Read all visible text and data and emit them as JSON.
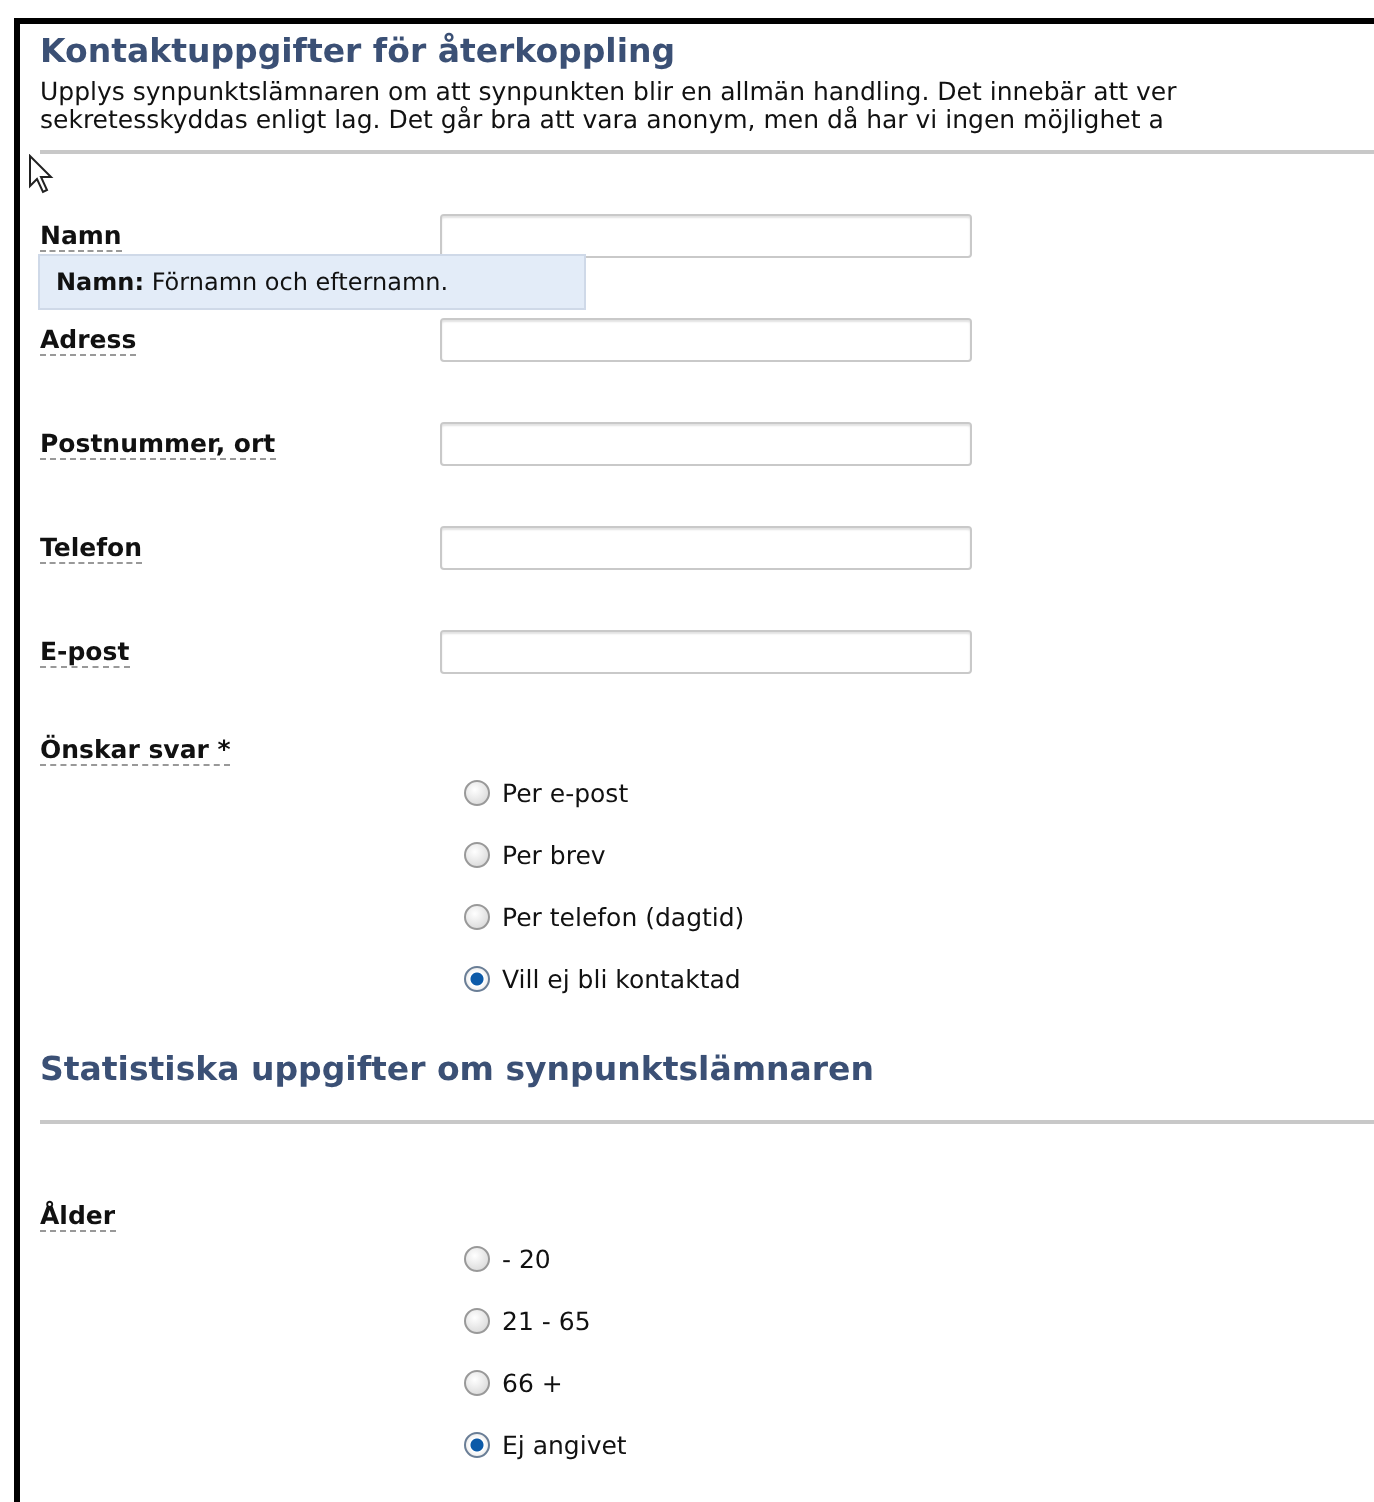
{
  "sections": [
    {
      "heading": "Kontaktuppgifter för återkoppling",
      "intro": [
        "Upplys synpunktslämnaren om att synpunkten blir en allmän handling. Det innebär att ver",
        "sekretesskyddas enligt lag. Det går bra att vara anonym, men då har vi ingen möjlighet a"
      ],
      "fields": [
        {
          "kind": "text",
          "label": "Namn",
          "tooltip": "**Namn:** Förnamn och efternamn."
        },
        {
          "kind": "text",
          "label": "Adress"
        },
        {
          "kind": "text",
          "label": "Postnummer, ort"
        },
        {
          "kind": "text",
          "label": "Telefon"
        },
        {
          "kind": "text",
          "label": "E-post"
        },
        {
          "kind": "radio",
          "label": "Önskar svar *",
          "options": [
            {
              "label": "Per e-post",
              "selected": false
            },
            {
              "label": "Per brev",
              "selected": false
            },
            {
              "label": "Per telefon (dagtid)",
              "selected": false
            },
            {
              "label": "Vill ej bli kontaktad",
              "selected": true
            }
          ]
        }
      ]
    },
    {
      "heading": "Statistiska uppgifter om synpunktslämnaren",
      "fields": [
        {
          "kind": "radio",
          "label": "Ålder",
          "options": [
            {
              "label": "- 20",
              "selected": false
            },
            {
              "label": "21 - 65",
              "selected": false
            },
            {
              "label": "66 +",
              "selected": false
            },
            {
              "label": "Ej angivet",
              "selected": true
            }
          ]
        }
      ]
    }
  ]
}
